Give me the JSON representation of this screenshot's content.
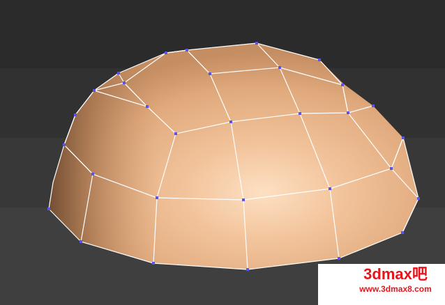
{
  "viewport": {
    "label": "3D viewport",
    "object": "hemisphere-mesh",
    "colors": {
      "mesh_base": "#e8b287",
      "mesh_highlight": "#fde0c2",
      "mesh_shadow": "#7a5236",
      "wire": "#ffffff",
      "vertex": "#5a55e6",
      "background": "#333333"
    }
  },
  "watermark": {
    "brand": "3dmax吧",
    "url": "www.3dmax8.com",
    "color": "#e8141c"
  }
}
